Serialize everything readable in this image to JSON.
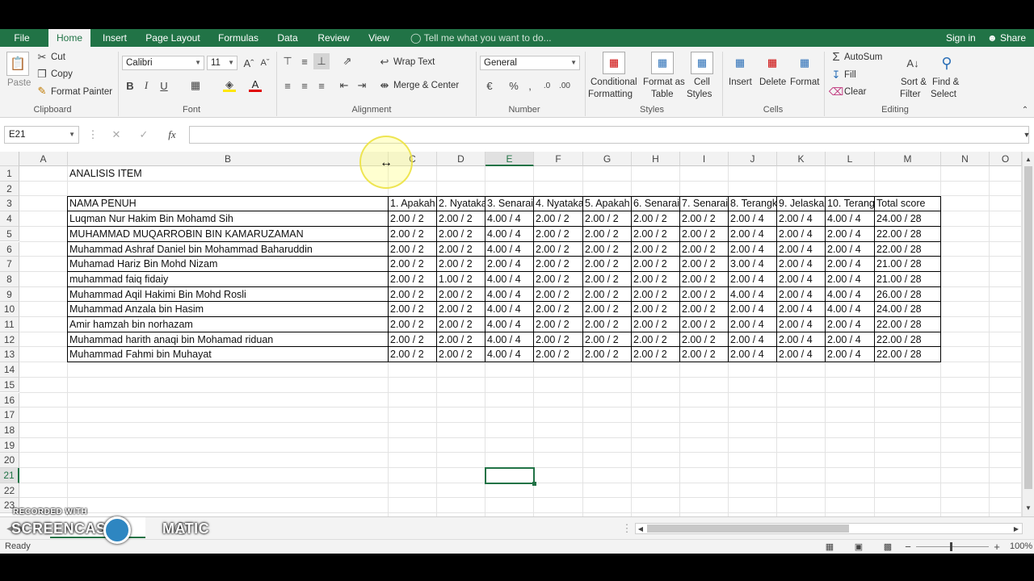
{
  "ribbon_tabs": [
    "File",
    "Home",
    "Insert",
    "Page Layout",
    "Formulas",
    "Data",
    "Review",
    "View"
  ],
  "active_tab": "Home",
  "tell_me": "Tell me what you want to do...",
  "sign_in": "Sign in",
  "share": "Share",
  "clipboard": {
    "paste": "Paste",
    "cut": "Cut",
    "copy": "Copy",
    "format_painter": "Format Painter",
    "label": "Clipboard"
  },
  "font": {
    "name": "Calibri",
    "size": "11",
    "label": "Font"
  },
  "alignment": {
    "wrap_text": "Wrap Text",
    "merge_center": "Merge & Center",
    "label": "Alignment"
  },
  "number": {
    "format": "General",
    "label": "Number"
  },
  "styles": {
    "conditional_1": "Conditional",
    "conditional_2": "Formatting",
    "format_table_1": "Format as",
    "format_table_2": "Table",
    "cell_styles_1": "Cell",
    "cell_styles_2": "Styles",
    "label": "Styles"
  },
  "cells": {
    "insert": "Insert",
    "delete": "Delete",
    "format": "Format",
    "label": "Cells"
  },
  "editing": {
    "autosum": "AutoSum",
    "fill": "Fill",
    "clear": "Clear",
    "sort_1": "Sort &",
    "sort_2": "Filter",
    "find_1": "Find &",
    "find_2": "Select",
    "label": "Editing"
  },
  "name_box": "E21",
  "columns": [
    "A",
    "B",
    "C",
    "D",
    "E",
    "F",
    "G",
    "H",
    "I",
    "J",
    "K",
    "L",
    "M",
    "N",
    "O"
  ],
  "rows": [
    "1",
    "2",
    "3",
    "4",
    "5",
    "6",
    "7",
    "8",
    "9",
    "10",
    "11",
    "12",
    "13",
    "14",
    "15",
    "16",
    "17",
    "18",
    "19",
    "20",
    "21",
    "22",
    "23"
  ],
  "sheet": {
    "title": "ANALISIS ITEM",
    "headers": [
      "NAMA PENUH",
      "1. Apakah",
      "2. Nyataka",
      "3. Senarai",
      "4. Nyataka",
      "5. Apakah",
      "6. Senarai",
      "7. Senarai",
      "8. Terangk",
      "9. Jelaskar",
      "10. Terang",
      "Total score"
    ],
    "data": [
      [
        "Luqman Nur Hakim Bin Mohamd Sih",
        "2.00 / 2",
        "2.00 / 2",
        "4.00 / 4",
        "2.00 / 2",
        "2.00 / 2",
        "2.00 / 2",
        "2.00 / 2",
        "2.00 / 4",
        "2.00 / 4",
        "4.00 / 4",
        "24.00 / 28"
      ],
      [
        "MUHAMMAD MUQARROBIN BIN KAMARUZAMAN",
        "2.00 / 2",
        "2.00 / 2",
        "4.00 / 4",
        "2.00 / 2",
        "2.00 / 2",
        "2.00 / 2",
        "2.00 / 2",
        "2.00 / 4",
        "2.00 / 4",
        "2.00 / 4",
        "22.00 / 28"
      ],
      [
        "Muhammad Ashraf Daniel bin Mohammad Baharuddin",
        "2.00 / 2",
        "2.00 / 2",
        "4.00 / 4",
        "2.00 / 2",
        "2.00 / 2",
        "2.00 / 2",
        "2.00 / 2",
        "2.00 / 4",
        "2.00 / 4",
        "2.00 / 4",
        "22.00 / 28"
      ],
      [
        "Muhamad Hariz Bin Mohd Nizam",
        "2.00 / 2",
        "2.00 / 2",
        "2.00 / 4",
        "2.00 / 2",
        "2.00 / 2",
        "2.00 / 2",
        "2.00 / 2",
        "3.00 / 4",
        "2.00 / 4",
        "2.00 / 4",
        "21.00 / 28"
      ],
      [
        "muhammad faiq fidaiy",
        "2.00 / 2",
        "1.00 / 2",
        "4.00 / 4",
        "2.00 / 2",
        "2.00 / 2",
        "2.00 / 2",
        "2.00 / 2",
        "2.00 / 4",
        "2.00 / 4",
        "2.00 / 4",
        "21.00 / 28"
      ],
      [
        "Muhammad Aqil Hakimi Bin Mohd Rosli",
        "2.00 / 2",
        "2.00 / 2",
        "4.00 / 4",
        "2.00 / 2",
        "2.00 / 2",
        "2.00 / 2",
        "2.00 / 2",
        "4.00 / 4",
        "2.00 / 4",
        "4.00 / 4",
        "26.00 / 28"
      ],
      [
        "Muhammad Anzala bin Hasim",
        "2.00 / 2",
        "2.00 / 2",
        "4.00 / 4",
        "2.00 / 2",
        "2.00 / 2",
        "2.00 / 2",
        "2.00 / 2",
        "2.00 / 4",
        "2.00 / 4",
        "4.00 / 4",
        "24.00 / 28"
      ],
      [
        "Amir hamzah bin norhazam",
        "2.00 / 2",
        "2.00 / 2",
        "4.00 / 4",
        "2.00 / 2",
        "2.00 / 2",
        "2.00 / 2",
        "2.00 / 2",
        "2.00 / 4",
        "2.00 / 4",
        "2.00 / 4",
        "22.00 / 28"
      ],
      [
        "Muhammad harith anaqi bin Mohamad riduan",
        "2.00 / 2",
        "2.00 / 2",
        "4.00 / 4",
        "2.00 / 2",
        "2.00 / 2",
        "2.00 / 2",
        "2.00 / 2",
        "2.00 / 4",
        "2.00 / 4",
        "2.00 / 4",
        "22.00 / 28"
      ],
      [
        "Muhammad Fahmi bin Muhayat",
        "2.00 / 2",
        "2.00 / 2",
        "4.00 / 4",
        "2.00 / 2",
        "2.00 / 2",
        "2.00 / 2",
        "2.00 / 2",
        "2.00 / 4",
        "2.00 / 4",
        "2.00 / 4",
        "22.00 / 28"
      ]
    ]
  },
  "status": {
    "ready": "Ready",
    "zoom": "100%"
  },
  "watermark": {
    "line1": "RECORDED WITH",
    "line2": "SCREENCAST",
    "line2b": "MATIC"
  },
  "colors": {
    "accent": "#217346",
    "highlight": "#f0e84a"
  }
}
